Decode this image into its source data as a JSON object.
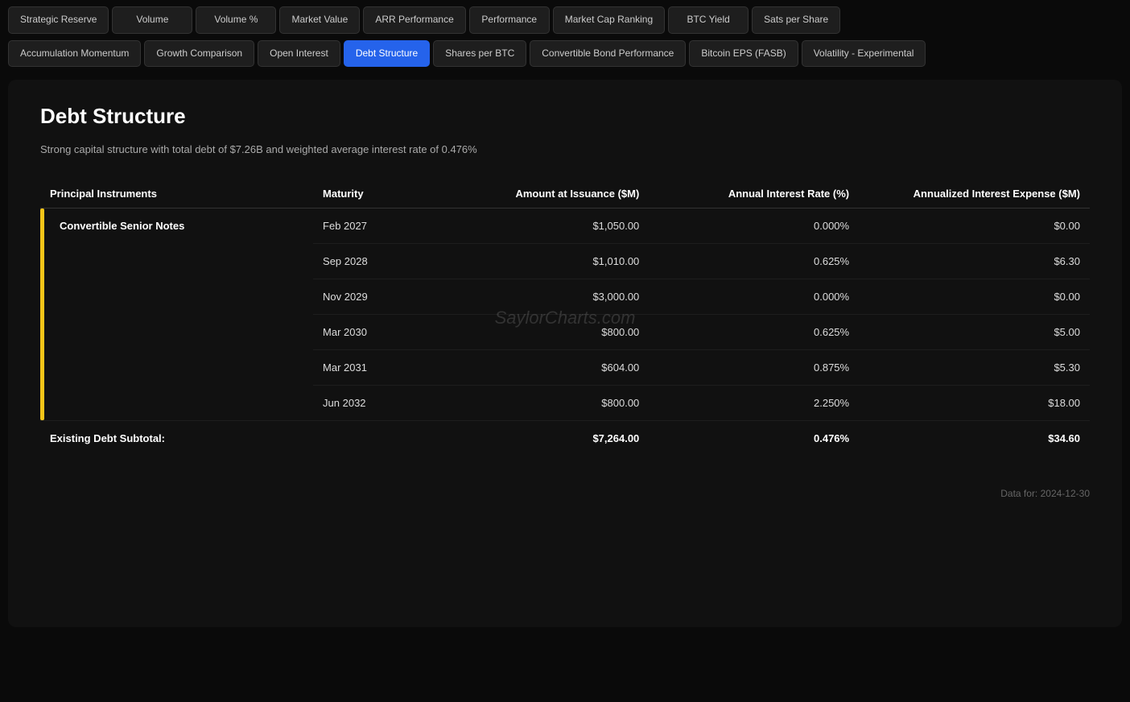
{
  "nav": {
    "row1": [
      {
        "label": "Strategic Reserve",
        "active": false
      },
      {
        "label": "Volume",
        "active": false
      },
      {
        "label": "Volume %",
        "active": false
      },
      {
        "label": "Market Value",
        "active": false
      },
      {
        "label": "ARR Performance",
        "active": false
      },
      {
        "label": "Performance",
        "active": false
      },
      {
        "label": "Market Cap Ranking",
        "active": false
      },
      {
        "label": "BTC Yield",
        "active": false
      },
      {
        "label": "Sats per Share",
        "active": false
      }
    ],
    "row2": [
      {
        "label": "Accumulation Momentum",
        "active": false
      },
      {
        "label": "Growth Comparison",
        "active": false
      },
      {
        "label": "Open Interest",
        "active": false
      },
      {
        "label": "Debt Structure",
        "active": true
      },
      {
        "label": "Shares per BTC",
        "active": false
      },
      {
        "label": "Convertible Bond Performance",
        "active": false
      },
      {
        "label": "Bitcoin EPS (FASB)",
        "active": false
      },
      {
        "label": "Volatility - Experimental",
        "active": false
      }
    ]
  },
  "page": {
    "title": "Debt Structure",
    "subtitle": "Strong capital structure with total debt of $7.26B and weighted average interest rate of 0.476%"
  },
  "table": {
    "headers": [
      "Principal Instruments",
      "Maturity",
      "Amount at Issuance ($M)",
      "Annual Interest Rate (%)",
      "Annualized Interest Expense ($M)"
    ],
    "group_label": "Convertible Senior Notes",
    "rows": [
      {
        "maturity": "Feb 2027",
        "amount": "$1,050.00",
        "rate": "0.000%",
        "expense": "$0.00"
      },
      {
        "maturity": "Sep 2028",
        "amount": "$1,010.00",
        "rate": "0.625%",
        "expense": "$6.30"
      },
      {
        "maturity": "Nov 2029",
        "amount": "$3,000.00",
        "rate": "0.000%",
        "expense": "$0.00"
      },
      {
        "maturity": "Mar 2030",
        "amount": "$800.00",
        "rate": "0.625%",
        "expense": "$5.00"
      },
      {
        "maturity": "Mar 2031",
        "amount": "$604.00",
        "rate": "0.875%",
        "expense": "$5.30"
      },
      {
        "maturity": "Jun 2032",
        "amount": "$800.00",
        "rate": "2.250%",
        "expense": "$18.00"
      }
    ],
    "subtotal": {
      "label": "Existing Debt Subtotal:",
      "amount": "$7,264.00",
      "rate": "0.476%",
      "expense": "$34.60"
    }
  },
  "watermark": "SaylorCharts.com",
  "data_date": "Data for: 2024-12-30"
}
